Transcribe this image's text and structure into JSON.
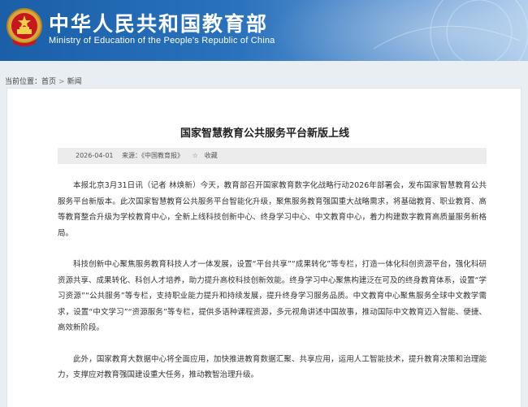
{
  "header": {
    "title_cn": "中华人民共和国教育部",
    "title_en": "Ministry of Education of the People's Republic of China",
    "emblem_icon": "national-emblem-icon",
    "brand_color": "#1a5fa8"
  },
  "breadcrumb": {
    "prefix": "当前位置：",
    "items": [
      "首页",
      "新闻"
    ],
    "separator": ">"
  },
  "article": {
    "title": "国家智慧教育公共服务平台新版上线",
    "date": "2026-04-01",
    "source": "来源：《中国教育报》",
    "favorite_label": "收藏",
    "paragraphs": [
      "本报北京3月31日讯（记者 林焕新）今天，教育部召开国家教育数字化战略行动2026年部署会，发布国家智慧教育公共服务平台新版本。此次国家智慧教育公共服务平台智能化升级，聚焦服务教育强国重大战略需求，将基础教育、职业教育、高等教育整合升级为学校教育中心，全新上线科技创新中心、终身学习中心、中文教育中心，着力构建数字教育高质量服务新格局。",
      "科技创新中心聚焦服务教育科技人才一体发展，设置“平台共享”“成果转化”等专栏，打造一体化科创资源平台，强化科研资源共享、成果转化、科创人才培养，助力提升高校科技创新效能。终身学习中心聚焦构建泛在可及的终身教育体系，设置“学习资源”“公共服务”等专栏，支持职业能力提升和持续发展，提升终身学习服务品质。中文教育中心聚焦服务全球中文教学需求，设置“中文学习”“资源服务”等专栏，提供多语种课程资源，多元视角讲述中国故事，推动国际中文教育迈入智能、便捷、高效新阶段。",
      "此外，国家教育大数据中心将全面应用，加快推进教育数据汇聚、共享应用，运用人工智能技术，提升教育决策和治理能力，支撑应对教育强国建设重大任务，推动教智治理升级。"
    ]
  }
}
